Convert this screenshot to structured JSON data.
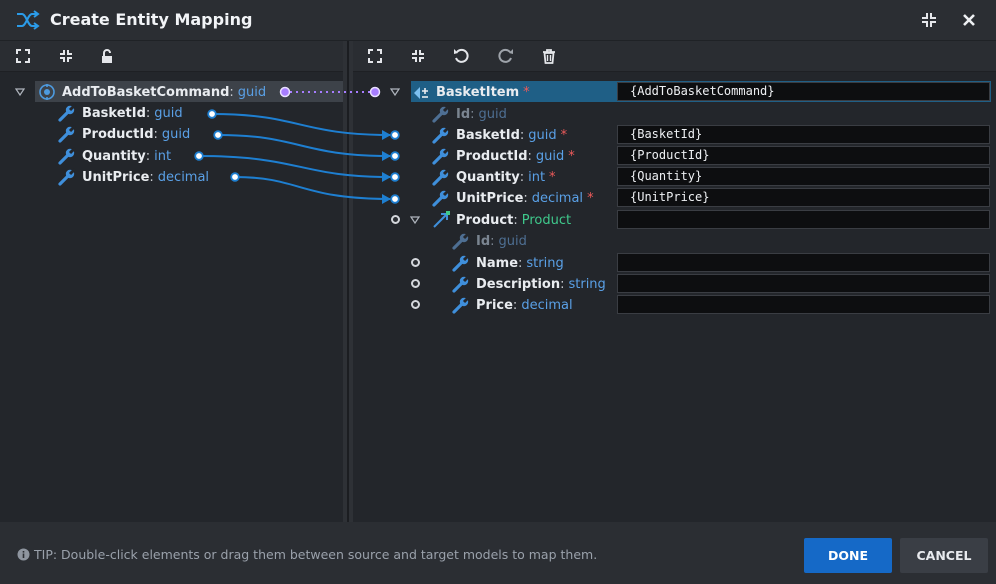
{
  "window": {
    "title": "Create Entity Mapping",
    "title_icon": "shuffle-icon",
    "buttons": [
      {
        "name": "restore-window-icon"
      },
      {
        "name": "close-icon"
      }
    ]
  },
  "left_toolbar": [
    "expand-all-icon",
    "collapse-all-icon",
    "unlock-icon"
  ],
  "right_toolbar": [
    "expand-all-icon",
    "collapse-all-icon",
    "undo-icon",
    "redo-icon",
    "delete-icon"
  ],
  "source": {
    "root": {
      "name": "AddToBasketCommand",
      "type": "guid",
      "icon": "command-icon"
    },
    "items": [
      {
        "name": "BasketId",
        "type": "guid"
      },
      {
        "name": "ProductId",
        "type": "guid"
      },
      {
        "name": "Quantity",
        "type": "int"
      },
      {
        "name": "UnitPrice",
        "type": "decimal"
      }
    ]
  },
  "target": {
    "root": {
      "name": "BasketItem",
      "required": "*",
      "mapping": "{AddToBasketCommand}",
      "icon": "class-icon"
    },
    "items": [
      {
        "name": "Id",
        "type": "guid",
        "required": "",
        "mapping": ""
      },
      {
        "name": "BasketId",
        "type": "guid",
        "required": "*",
        "mapping": "{BasketId}"
      },
      {
        "name": "ProductId",
        "type": "guid",
        "required": "*",
        "mapping": "{ProductId}"
      },
      {
        "name": "Quantity",
        "type": "int",
        "required": "*",
        "mapping": "{Quantity}"
      },
      {
        "name": "UnitPrice",
        "type": "decimal",
        "required": "*",
        "mapping": "{UnitPrice}"
      },
      {
        "name": "Product",
        "type": "Product",
        "required": "",
        "mapping": ""
      }
    ],
    "product_children": [
      {
        "name": "Id",
        "type": "guid",
        "mapping": ""
      },
      {
        "name": "Name",
        "type": "string",
        "mapping": ""
      },
      {
        "name": "Description",
        "type": "string",
        "mapping": ""
      },
      {
        "name": "Price",
        "type": "decimal",
        "mapping": ""
      }
    ]
  },
  "colors": {
    "accent_blue": "#1e7fd1",
    "mapping_purple": "#a77dff",
    "selection_blue": "#1f5f86",
    "done_button": "#1569c7",
    "required_red": "#ee5a5a",
    "association_green": "#3fc98c"
  },
  "footer": {
    "tip_icon": "info-icon",
    "tip": "TIP: Double-click elements or drag them between source and target models to map them.",
    "done": "DONE",
    "cancel": "CANCEL"
  }
}
